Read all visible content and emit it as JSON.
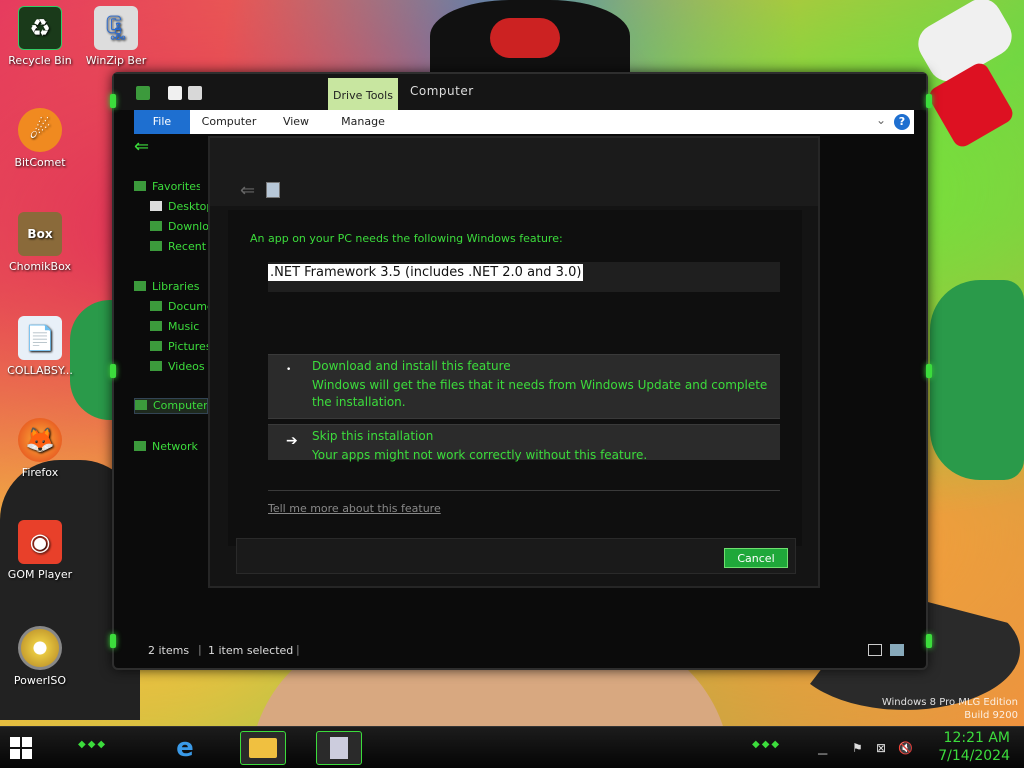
{
  "desktop": {
    "icons": [
      {
        "label": "Recycle Bin",
        "icon": "recycle-bin-icon"
      },
      {
        "label": "WinZip Ber",
        "icon": "winzip-icon"
      },
      {
        "label": "BitComet",
        "icon": "bitcomet-icon"
      },
      {
        "label": "ChomikBox",
        "icon": "chomikbox-icon"
      },
      {
        "label": "COLLABSY...",
        "icon": "collabsy-icon"
      },
      {
        "label": "Firefox",
        "icon": "firefox-icon"
      },
      {
        "label": "GOM Player",
        "icon": "gom-player-icon"
      },
      {
        "label": "PowerISO",
        "icon": "poweriso-icon"
      }
    ],
    "chomikbox_badge": "Box",
    "watermark_line1": "Windows 8 Pro MLG Edition",
    "watermark_line2": "Build 9200"
  },
  "explorer": {
    "title": "Computer",
    "contextual_tab_group": "Drive Tools",
    "ribbon_tabs": [
      "File",
      "Computer",
      "View",
      "Manage"
    ],
    "nav_items": [
      {
        "label": "Favorites"
      },
      {
        "label": "Desktop"
      },
      {
        "label": "Downloads"
      },
      {
        "label": "Recent places"
      },
      {
        "label": "Libraries"
      },
      {
        "label": "Documents"
      },
      {
        "label": "Music"
      },
      {
        "label": "Pictures"
      },
      {
        "label": "Videos"
      },
      {
        "label": "Computer"
      },
      {
        "label": "Network"
      }
    ],
    "status": {
      "items": "2 items",
      "selected": "1 item selected"
    },
    "help_label": "?"
  },
  "dialog": {
    "prompt": "An app on your PC needs the following Windows feature:",
    "feature_name": ".NET Framework 3.5 (includes .NET 2.0 and 3.0)",
    "option_download": {
      "title": "Download and install this feature",
      "description": "Windows will get the files that it needs from Windows Update and complete the installation."
    },
    "option_skip": {
      "title": "Skip this installation",
      "description": "Your apps might not work correctly without this feature."
    },
    "tell_more": "Tell me more about this feature",
    "cancel_label": "Cancel"
  },
  "taskbar": {
    "time": "12:21 AM",
    "date": "7/14/2024"
  },
  "colors": {
    "accent_green": "#3cdc3c",
    "ribbon_file_blue": "#1e6fd0",
    "cancel_green": "#1fa83a",
    "drive_tools_bg": "#c8e6a0"
  }
}
